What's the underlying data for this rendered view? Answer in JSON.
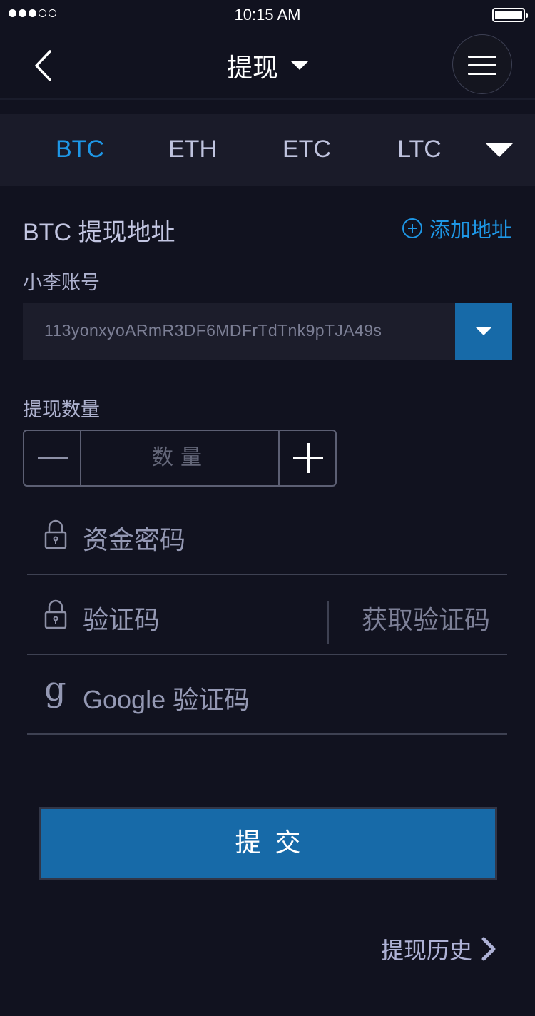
{
  "status_bar": {
    "signal_dots_filled": 3,
    "signal_dots_total": 5,
    "time": "10:15 AM"
  },
  "nav": {
    "title": "提现",
    "back_icon": "chevron-left-icon",
    "menu_icon": "hamburger-menu-icon"
  },
  "coin_tabs": {
    "items": [
      {
        "label": "BTC",
        "active": true
      },
      {
        "label": "ETH",
        "active": false
      },
      {
        "label": "ETC",
        "active": false
      },
      {
        "label": "LTC",
        "active": false
      }
    ],
    "more_icon": "caret-down-icon"
  },
  "address_section": {
    "title": "BTC 提现地址",
    "add_label": "添加地址",
    "account_label": "小李账号",
    "address_value": "113yonxyoARmR3DF6MDFrTdTnk9pTJA49s"
  },
  "quantity": {
    "label": "提现数量",
    "placeholder": "数量"
  },
  "form": {
    "fund_password_placeholder": "资金密码",
    "sms_code_placeholder": "验证码",
    "get_code_label": "获取验证码",
    "google_code_placeholder": "Google 验证码",
    "google_icon_glyph": "g"
  },
  "submit_label": "提交",
  "history_label": "提现历史",
  "colors": {
    "background": "#11121f",
    "accent": "#1e97e6",
    "button": "#176aa8"
  }
}
